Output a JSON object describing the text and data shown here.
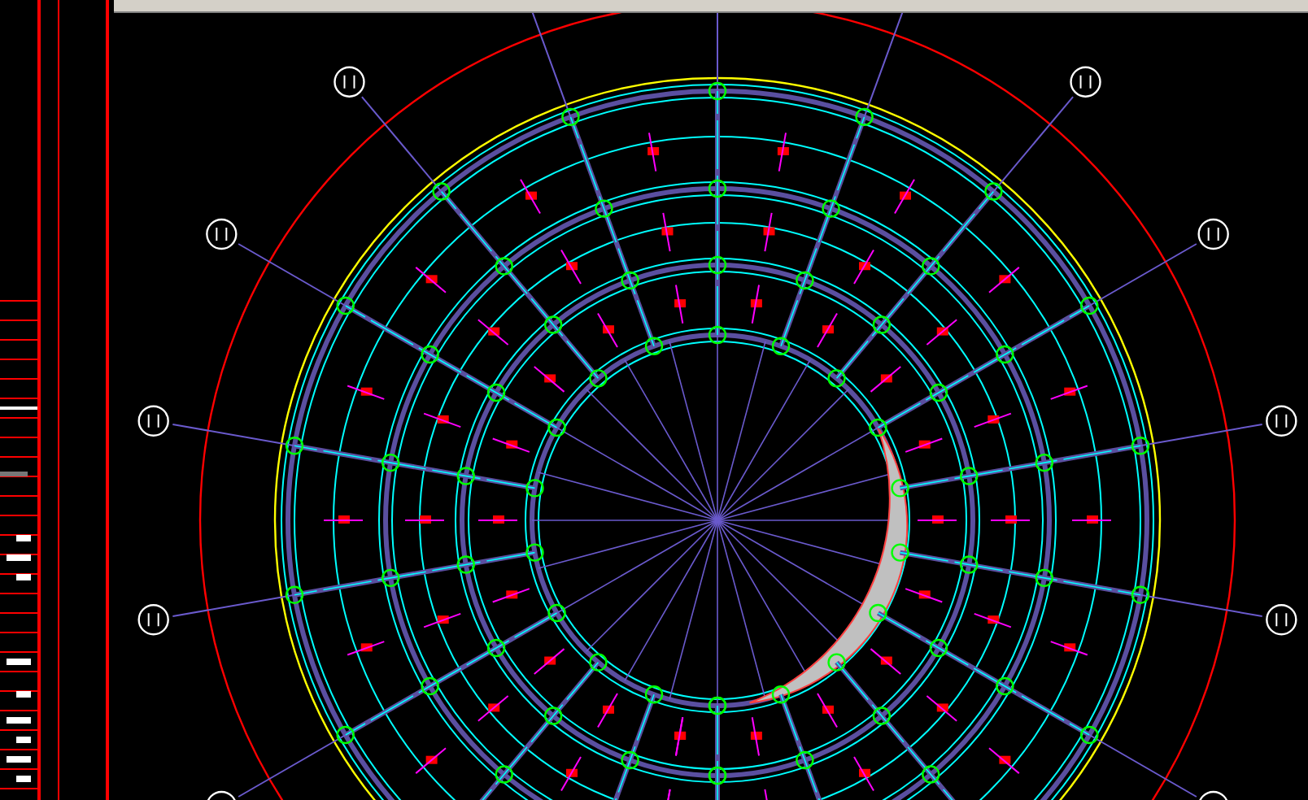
{
  "canvas": {
    "kind": "radial-floor-plan"
  },
  "left_panel": {
    "kind": "title-block"
  }
}
